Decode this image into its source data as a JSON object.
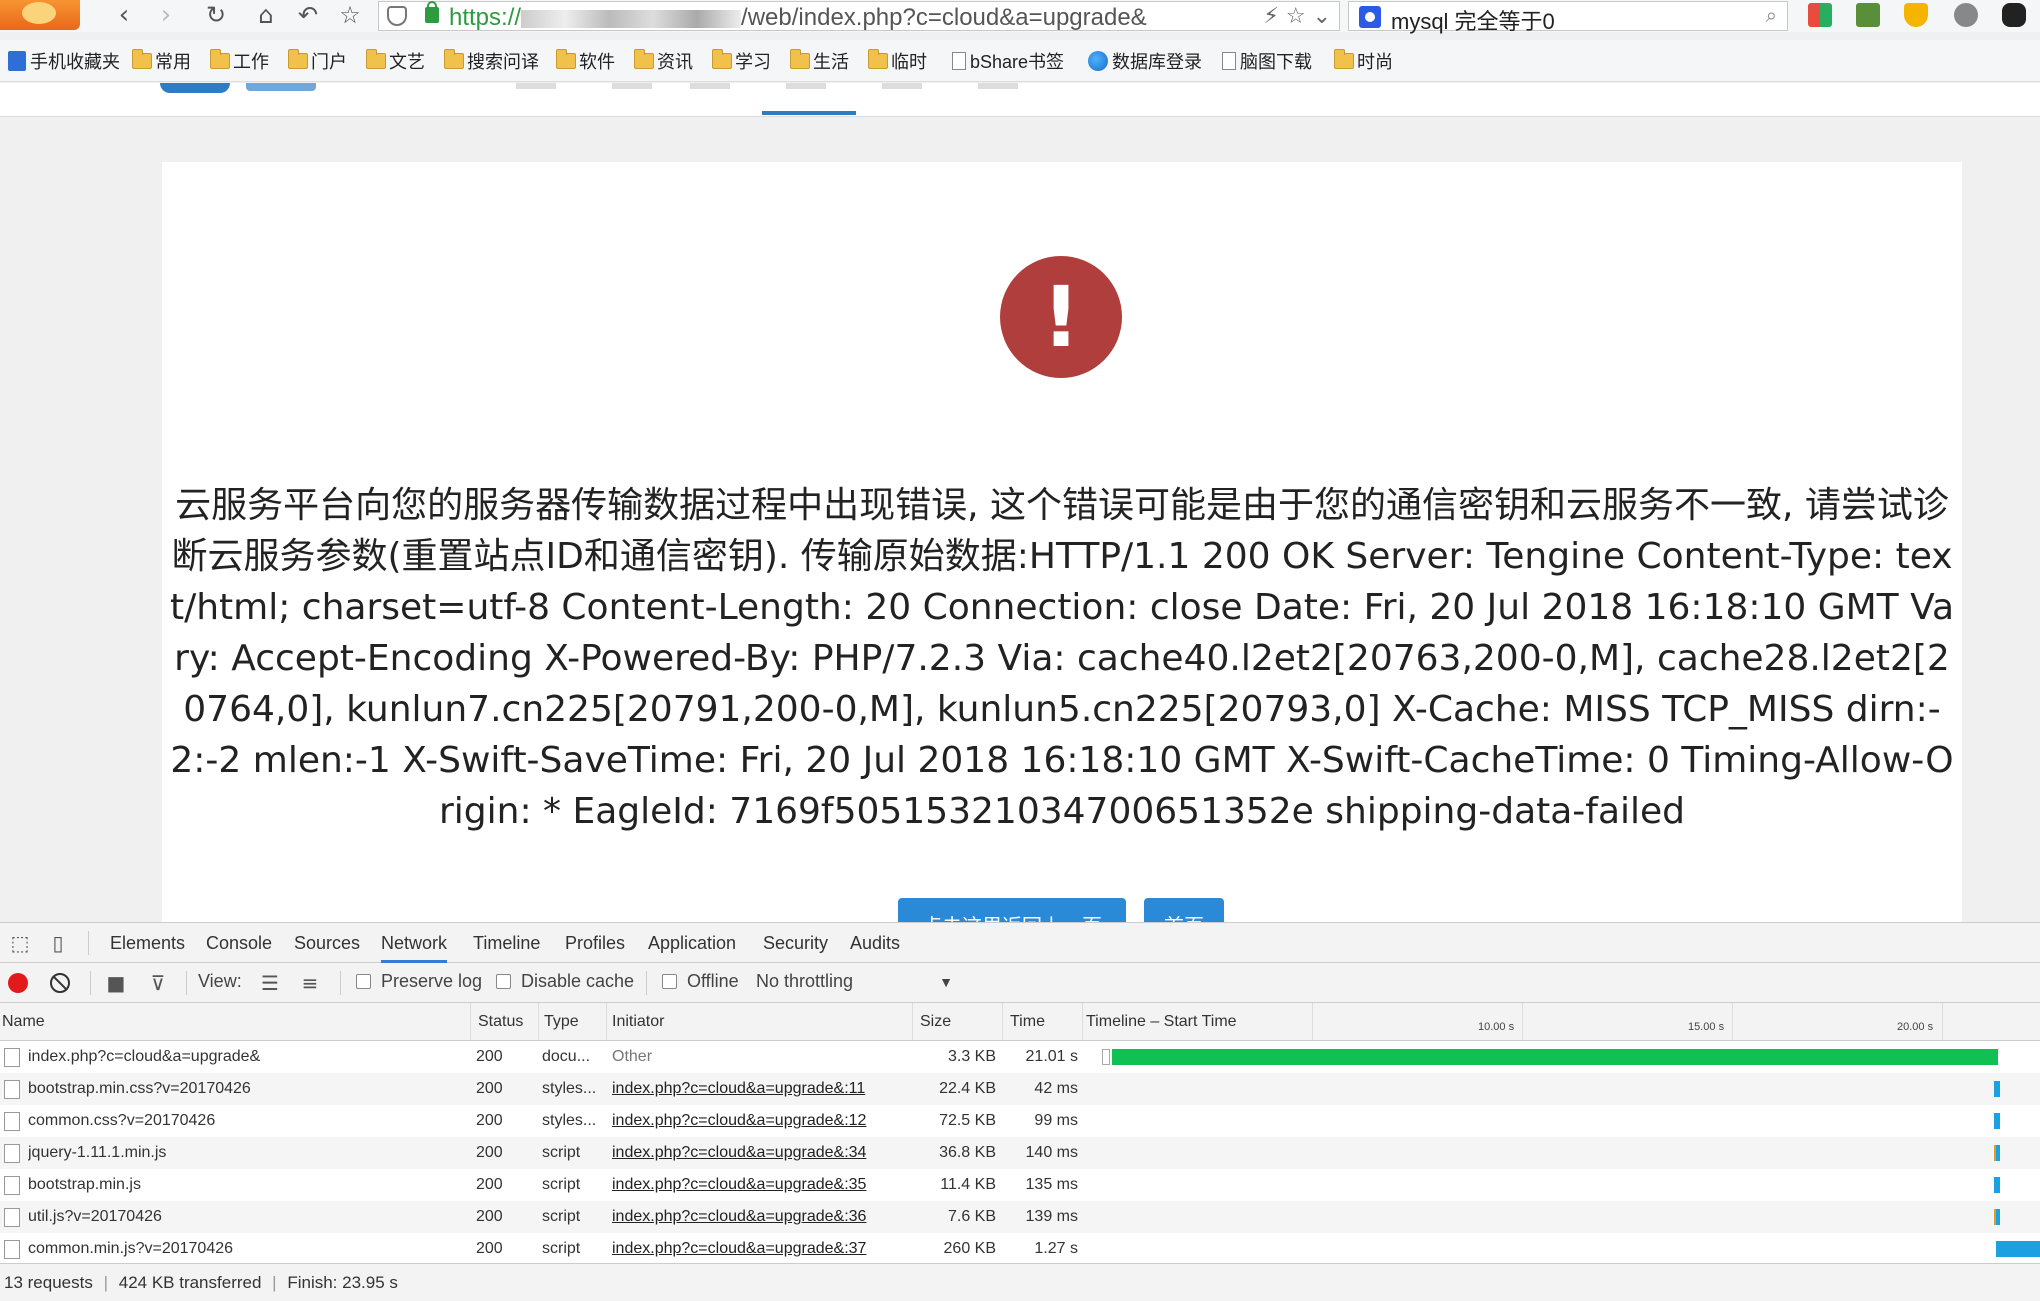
{
  "browser": {
    "url_scheme": "https://",
    "url_path": "/web/index.php?c=cloud&a=upgrade&",
    "search_query": "mysql 完全等于0",
    "bookmarks": [
      "手机收藏夹",
      "常用",
      "工作",
      "门户",
      "文艺",
      "搜索问译",
      "软件",
      "资讯",
      "学习",
      "生活",
      "临时",
      "bShare书签",
      "数据库登录",
      "脑图下载",
      "时尚"
    ]
  },
  "page": {
    "error_message": "云服务平台向您的服务器传输数据过程中出现错误, 这个错误可能是由于您的通信密钥和云服务不一致, 请尝试诊断云服务参数(重置站点ID和通信密钥). 传输原始数据:HTTP/1.1 200 OK Server: Tengine Content-Type: text/html; charset=utf-8 Content-Length: 20 Connection: close Date: Fri, 20 Jul 2018 16:18:10 GMT Vary: Accept-Encoding X-Powered-By: PHP/7.2.3 Via: cache40.l2et2[20763,200-0,M], cache28.l2et2[20764,0], kunlun7.cn225[20791,200-0,M], kunlun5.cn225[20793,0] X-Cache: MISS TCP_MISS dirn:-2:-2 mlen:-1 X-Swift-SaveTime: Fri, 20 Jul 2018 16:18:10 GMT X-Swift-CacheTime: 0 Timing-Allow-Origin: * EagleId: 7169f50515321034700651352e shipping-data-failed",
    "back_button": "点击这里返回上一页",
    "home_button": "首页"
  },
  "devtools": {
    "tabs": [
      "Elements",
      "Console",
      "Sources",
      "Network",
      "Timeline",
      "Profiles",
      "Application",
      "Security",
      "Audits"
    ],
    "active_tab": "Network",
    "toolbar": {
      "view_label": "View:",
      "preserve_log": "Preserve log",
      "disable_cache": "Disable cache",
      "offline": "Offline",
      "throttling": "No throttling"
    },
    "columns": {
      "name": "Name",
      "status": "Status",
      "type": "Type",
      "initiator": "Initiator",
      "size": "Size",
      "time": "Time",
      "timeline": "Timeline – Start Time"
    },
    "timeline_ticks": [
      "10.00 s",
      "15.00 s",
      "20.00 s"
    ],
    "rows": [
      {
        "name": "index.php?c=cloud&a=upgrade&",
        "status": "200",
        "type": "docu...",
        "initiator": "Other",
        "size": "3.3 KB",
        "time": "21.01 s"
      },
      {
        "name": "bootstrap.min.css?v=20170426",
        "status": "200",
        "type": "styles...",
        "initiator": "index.php?c=cloud&a=upgrade&:11",
        "size": "22.4 KB",
        "time": "42 ms"
      },
      {
        "name": "common.css?v=20170426",
        "status": "200",
        "type": "styles...",
        "initiator": "index.php?c=cloud&a=upgrade&:12",
        "size": "72.5 KB",
        "time": "99 ms"
      },
      {
        "name": "jquery-1.11.1.min.js",
        "status": "200",
        "type": "script",
        "initiator": "index.php?c=cloud&a=upgrade&:34",
        "size": "36.8 KB",
        "time": "140 ms"
      },
      {
        "name": "bootstrap.min.js",
        "status": "200",
        "type": "script",
        "initiator": "index.php?c=cloud&a=upgrade&:35",
        "size": "11.4 KB",
        "time": "135 ms"
      },
      {
        "name": "util.js?v=20170426",
        "status": "200",
        "type": "script",
        "initiator": "index.php?c=cloud&a=upgrade&:36",
        "size": "7.6 KB",
        "time": "139 ms"
      },
      {
        "name": "common.min.js?v=20170426",
        "status": "200",
        "type": "script",
        "initiator": "index.php?c=cloud&a=upgrade&:37",
        "size": "260 KB",
        "time": "1.27 s"
      }
    ],
    "status_bar": {
      "requests": "13 requests",
      "transferred": "424 KB transferred",
      "finish": "Finish: 23.95 s"
    },
    "colors": {
      "doc_bar": "#0fc152",
      "resource_bar": "#1ba1e2",
      "script_bar": "#d4a12a"
    }
  }
}
